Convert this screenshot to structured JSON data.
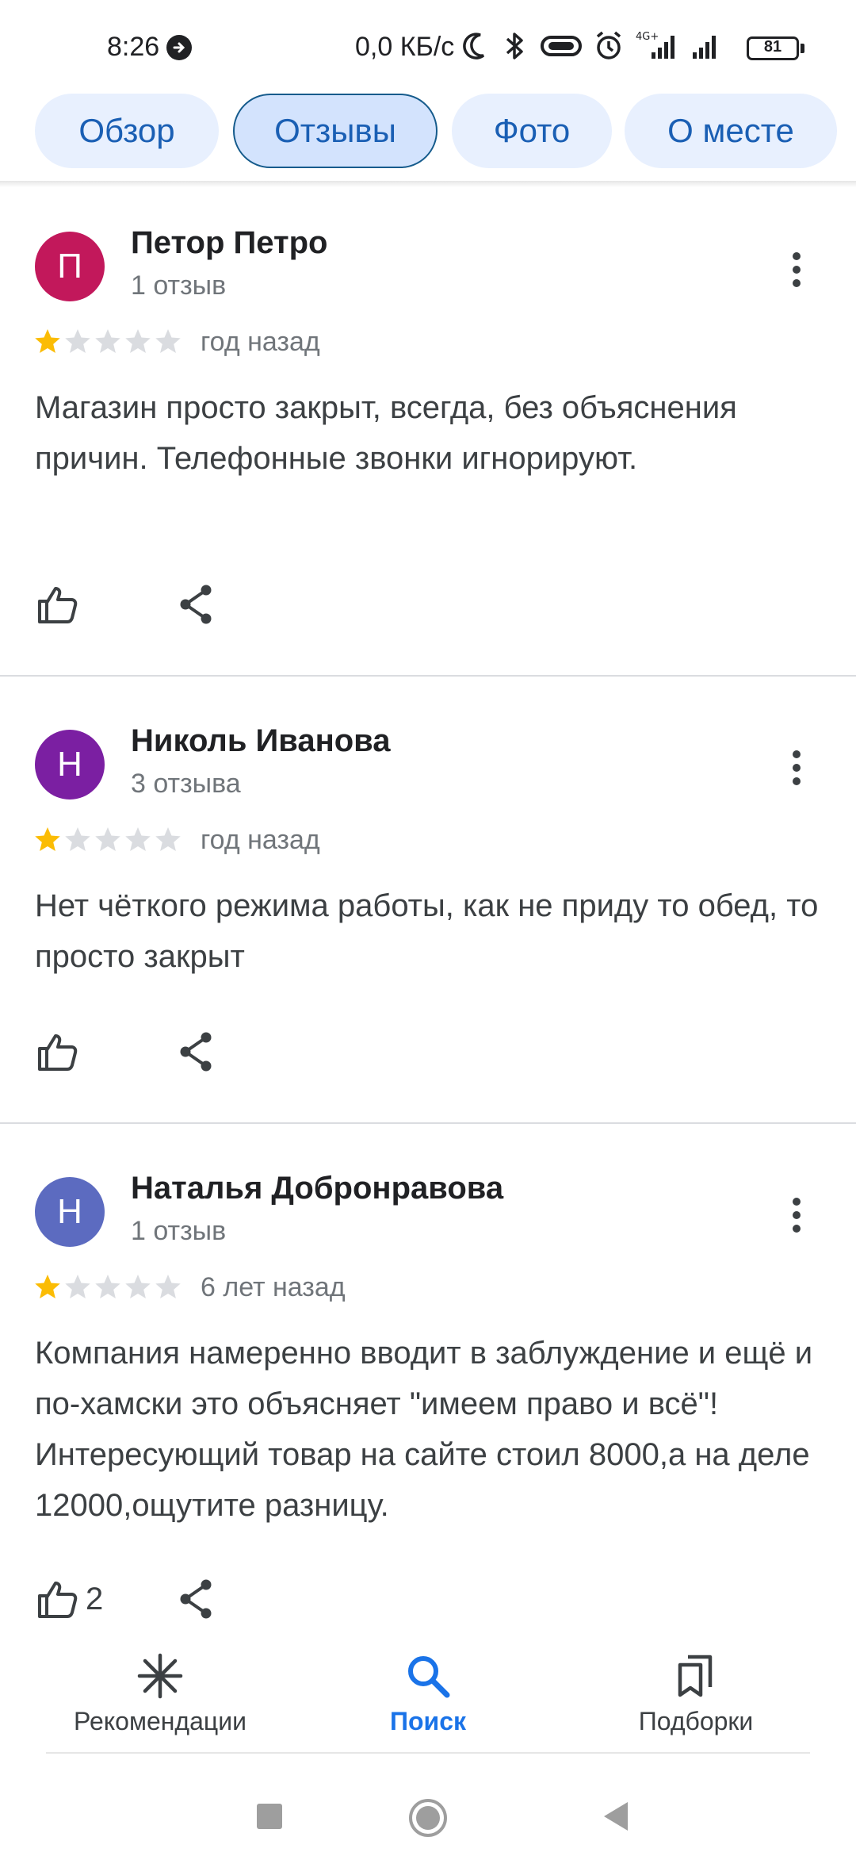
{
  "status_bar": {
    "time": "8:26",
    "network_speed": "0,0 КБ/с",
    "battery": "81",
    "icons": [
      "navigation-arrow-icon",
      "moon-icon",
      "bluetooth-icon",
      "vibrate-icon",
      "alarm-icon",
      "signal-4g-icon",
      "signal-icon",
      "battery-icon"
    ]
  },
  "tabs": [
    {
      "label": "Обзор",
      "active": false
    },
    {
      "label": "Отзывы",
      "active": true
    },
    {
      "label": "Фото",
      "active": false
    },
    {
      "label": "О месте",
      "active": false
    }
  ],
  "reviews": [
    {
      "avatar_letter": "П",
      "avatar_color": "#c2185b",
      "author": "Петор Петро",
      "review_count": "1 отзыв",
      "rating": 1,
      "max_rating": 5,
      "time": "год назад",
      "text": "Магазин просто закрыт, всегда, без объяснения причин. Телефонные звонки игнорируют.",
      "likes": ""
    },
    {
      "avatar_letter": "Н",
      "avatar_color": "#7b1fa2",
      "author": "Николь Иванова",
      "review_count": "3 отзыва",
      "rating": 1,
      "max_rating": 5,
      "time": "год назад",
      "text": "Нет чёткого режима работы, как не приду то обед, то просто закрыт",
      "likes": ""
    },
    {
      "avatar_letter": "Н",
      "avatar_color": "#5c6bc0",
      "author": "Наталья Добронравова",
      "review_count": "1 отзыв",
      "rating": 1,
      "max_rating": 5,
      "time": "6 лет назад",
      "text": "Компания намеренно вводит в заблуждение и ещё и по-хамски это объясняет \"имеем право и всё\"!Интересующий товар на сайте стоил 8000,а на деле 12000,ощутите разницу.",
      "likes": "2"
    }
  ],
  "bottom_nav": [
    {
      "label": "Рекомендации",
      "icon": "explore-icon",
      "active": false
    },
    {
      "label": "Поиск",
      "icon": "search-icon",
      "active": true
    },
    {
      "label": "Подборки",
      "icon": "bookmarks-icon",
      "active": false
    }
  ],
  "system_nav": [
    "recents-button",
    "home-button",
    "back-button"
  ],
  "colors": {
    "accent": "#1a73e8",
    "tab_bg": "#e8f0fe",
    "star_filled": "#fbbc04",
    "star_empty": "#dadce0"
  }
}
